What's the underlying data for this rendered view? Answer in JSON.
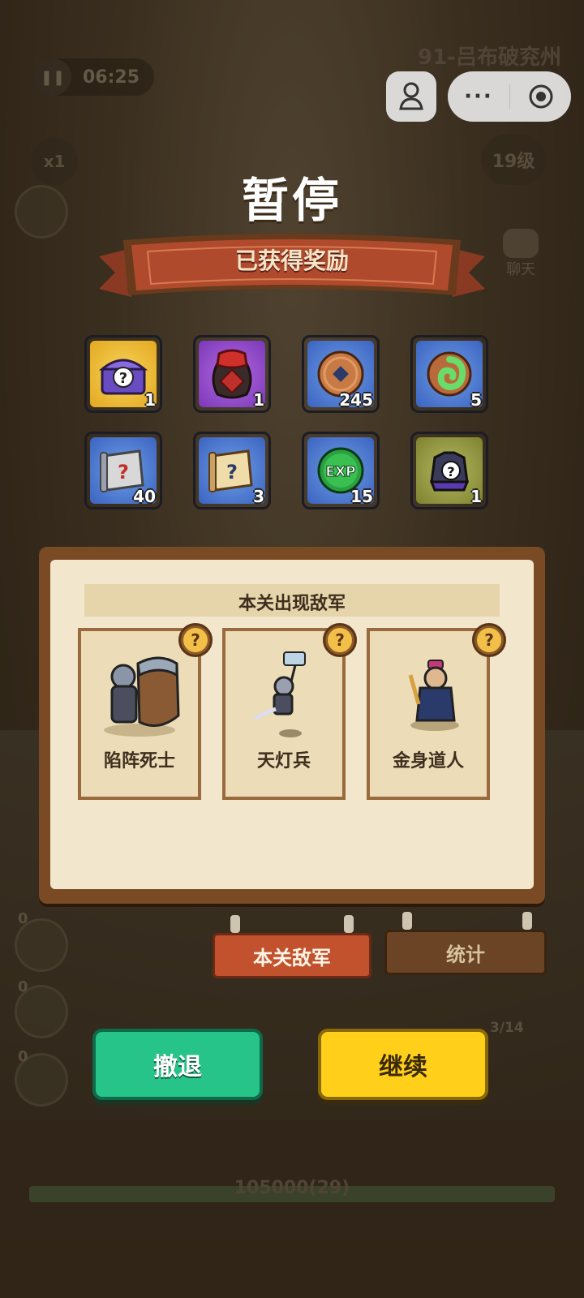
{
  "hud": {
    "timer": "06:25",
    "pause_icon": "❚❚",
    "level_name": "91-吕布破兖州",
    "speed": "x1",
    "player_level": "19级",
    "chat_label": "聊天",
    "capsule_dots": "···",
    "side_counts": [
      "0",
      "0",
      "0"
    ],
    "troops": "3/14",
    "progress_text": "105000(29)"
  },
  "pause": {
    "title": "暂停",
    "rewards_banner": "已获得奖励"
  },
  "rewards": [
    {
      "icon": "mystery-chest-icon",
      "color": "gold",
      "count": "1"
    },
    {
      "icon": "wine-jar-icon",
      "color": "purple",
      "count": "1"
    },
    {
      "icon": "copper-coin-icon",
      "color": "blue",
      "count": "245"
    },
    {
      "icon": "jade-icon",
      "color": "blue",
      "count": "5"
    },
    {
      "icon": "mystery-scroll-icon",
      "color": "blue",
      "count": "40"
    },
    {
      "icon": "scroll-icon",
      "color": "blue",
      "count": "3"
    },
    {
      "icon": "exp-orb-icon",
      "color": "blue",
      "count": "15"
    },
    {
      "icon": "mystery-armor-icon",
      "color": "olive",
      "count": "1"
    }
  ],
  "enemies": {
    "header": "本关出现敌军",
    "list": [
      {
        "name": "陷阵死士",
        "icon": "shield-soldier-icon"
      },
      {
        "name": "天灯兵",
        "icon": "lantern-soldier-icon"
      },
      {
        "name": "金身道人",
        "icon": "taoist-icon"
      }
    ],
    "help_mark": "?"
  },
  "tabs": {
    "enemies": "本关敌军",
    "stats": "统计"
  },
  "buttons": {
    "retreat": "撤退",
    "continue": "继续"
  },
  "colors": {
    "retreat": "#27c48a",
    "continue": "#ffcf1a",
    "active_tab": "#c2522e"
  }
}
